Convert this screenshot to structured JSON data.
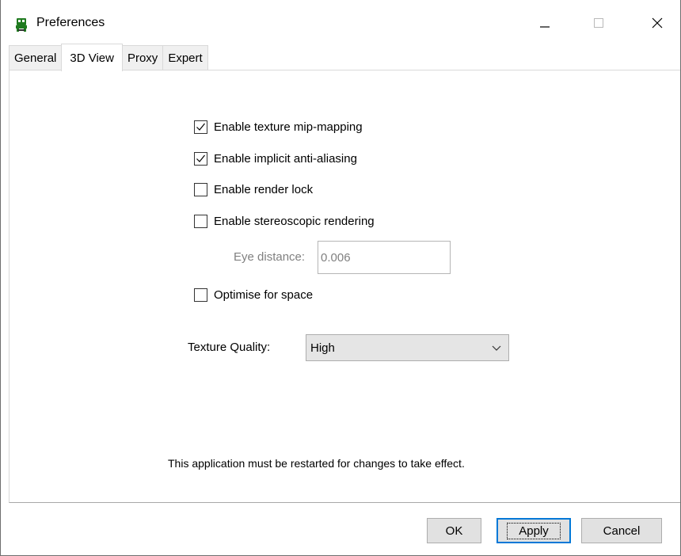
{
  "window": {
    "title": "Preferences",
    "icon": "robot-app-icon",
    "controls": {
      "minimize": "minimize-icon",
      "maximize": "maximize-icon",
      "close": "close-icon"
    }
  },
  "tabs": [
    {
      "label": "General",
      "active": false
    },
    {
      "label": "3D View",
      "active": true
    },
    {
      "label": "Proxy",
      "active": false
    },
    {
      "label": "Expert",
      "active": false
    }
  ],
  "options": {
    "mipmapping": {
      "label": "Enable texture mip-mapping",
      "checked": true
    },
    "antialiasing": {
      "label": "Enable implicit anti-aliasing",
      "checked": true
    },
    "render_lock": {
      "label": "Enable render lock",
      "checked": false
    },
    "stereoscopic": {
      "label": "Enable stereoscopic rendering",
      "checked": false
    },
    "optimise_space": {
      "label": "Optimise for space",
      "checked": false
    }
  },
  "eye_distance": {
    "label": "Eye distance:",
    "value": "0.006",
    "enabled": false
  },
  "texture_quality": {
    "label": "Texture Quality:",
    "selected": "High"
  },
  "note": "This application must be restarted for changes to take effect.",
  "buttons": {
    "ok": "OK",
    "apply": "Apply",
    "cancel": "Cancel"
  },
  "colors": {
    "focus_border": "#0078d7",
    "disabled_text": "#808080",
    "button_face": "#e1e1e1",
    "icon_green": "#1f7a1f"
  }
}
